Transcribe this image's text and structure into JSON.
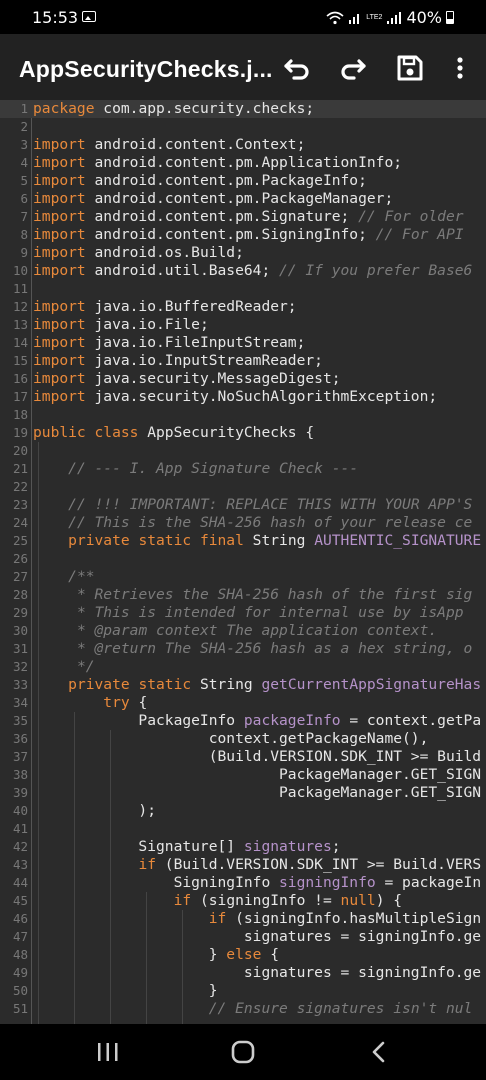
{
  "status_bar": {
    "time": "15:53",
    "battery": "40%",
    "network_label": "LTE2",
    "icons": [
      "image-icon",
      "wifi-icon",
      "signal-icon",
      "signal-icon",
      "battery-icon"
    ]
  },
  "toolbar": {
    "title": "AppSecurityChecks.j...",
    "buttons": [
      "undo-icon",
      "redo-icon",
      "save-icon",
      "more-vert-icon"
    ]
  },
  "editor": {
    "lines": [
      {
        "n": "1",
        "t": [
          [
            "kw",
            "package"
          ],
          [
            "p",
            " com.app.security.checks;"
          ]
        ]
      },
      {
        "n": "2",
        "t": []
      },
      {
        "n": "3",
        "t": [
          [
            "kw",
            "import"
          ],
          [
            "p",
            " android.content.Context;"
          ]
        ]
      },
      {
        "n": "4",
        "t": [
          [
            "kw",
            "import"
          ],
          [
            "p",
            " android.content.pm.ApplicationInfo;"
          ]
        ]
      },
      {
        "n": "5",
        "t": [
          [
            "kw",
            "import"
          ],
          [
            "p",
            " android.content.pm.PackageInfo;"
          ]
        ]
      },
      {
        "n": "6",
        "t": [
          [
            "kw",
            "import"
          ],
          [
            "p",
            " android.content.pm.PackageManager;"
          ]
        ]
      },
      {
        "n": "7",
        "t": [
          [
            "kw",
            "import"
          ],
          [
            "p",
            " android.content.pm.Signature; "
          ],
          [
            "cm",
            "// For older"
          ]
        ]
      },
      {
        "n": "8",
        "t": [
          [
            "kw",
            "import"
          ],
          [
            "p",
            " android.content.pm.SigningInfo; "
          ],
          [
            "cm",
            "// For API"
          ]
        ]
      },
      {
        "n": "9",
        "t": [
          [
            "kw",
            "import"
          ],
          [
            "p",
            " android.os.Build;"
          ]
        ]
      },
      {
        "n": "10",
        "t": [
          [
            "kw",
            "import"
          ],
          [
            "p",
            " android.util.Base64; "
          ],
          [
            "cm",
            "// If you prefer Base6"
          ]
        ]
      },
      {
        "n": "11",
        "t": []
      },
      {
        "n": "12",
        "t": [
          [
            "kw",
            "import"
          ],
          [
            "p",
            " java.io.BufferedReader;"
          ]
        ]
      },
      {
        "n": "13",
        "t": [
          [
            "kw",
            "import"
          ],
          [
            "p",
            " java.io.File;"
          ]
        ]
      },
      {
        "n": "14",
        "t": [
          [
            "kw",
            "import"
          ],
          [
            "p",
            " java.io.FileInputStream;"
          ]
        ]
      },
      {
        "n": "15",
        "t": [
          [
            "kw",
            "import"
          ],
          [
            "p",
            " java.io.InputStreamReader;"
          ]
        ]
      },
      {
        "n": "16",
        "t": [
          [
            "kw",
            "import"
          ],
          [
            "p",
            " java.security.MessageDigest;"
          ]
        ]
      },
      {
        "n": "17",
        "t": [
          [
            "kw",
            "import"
          ],
          [
            "p",
            " java.security.NoSuchAlgorithmException;"
          ]
        ]
      },
      {
        "n": "18",
        "t": []
      },
      {
        "n": "19",
        "t": [
          [
            "kw",
            "public class"
          ],
          [
            "p",
            " AppSecurityChecks {"
          ]
        ]
      },
      {
        "n": "20",
        "t": []
      },
      {
        "n": "21",
        "t": [
          [
            "p",
            "    "
          ],
          [
            "cm",
            "// --- I. App Signature Check ---"
          ]
        ]
      },
      {
        "n": "22",
        "t": []
      },
      {
        "n": "23",
        "t": [
          [
            "p",
            "    "
          ],
          [
            "cm",
            "// !!! IMPORTANT: REPLACE THIS WITH YOUR APP'S"
          ]
        ]
      },
      {
        "n": "24",
        "t": [
          [
            "p",
            "    "
          ],
          [
            "cm",
            "// This is the SHA-256 hash of your release ce"
          ]
        ]
      },
      {
        "n": "25",
        "t": [
          [
            "p",
            "    "
          ],
          [
            "kw",
            "private static final"
          ],
          [
            "p",
            " String "
          ],
          [
            "fld",
            "AUTHENTIC_SIGNATURE"
          ]
        ]
      },
      {
        "n": "26",
        "t": []
      },
      {
        "n": "27",
        "t": [
          [
            "p",
            "    "
          ],
          [
            "cm",
            "/**"
          ]
        ]
      },
      {
        "n": "28",
        "t": [
          [
            "p",
            "     "
          ],
          [
            "cm",
            "* Retrieves the SHA-256 hash of the first sig"
          ]
        ]
      },
      {
        "n": "29",
        "t": [
          [
            "p",
            "     "
          ],
          [
            "cm",
            "* This is intended for internal use by isApp"
          ]
        ]
      },
      {
        "n": "30",
        "t": [
          [
            "p",
            "     "
          ],
          [
            "cm",
            "* @param context The application context."
          ]
        ]
      },
      {
        "n": "31",
        "t": [
          [
            "p",
            "     "
          ],
          [
            "cm",
            "* @return The SHA-256 hash as a hex string, o"
          ]
        ]
      },
      {
        "n": "32",
        "t": [
          [
            "p",
            "     "
          ],
          [
            "cm",
            "*/"
          ]
        ]
      },
      {
        "n": "33",
        "t": [
          [
            "p",
            "    "
          ],
          [
            "kw",
            "private static"
          ],
          [
            "p",
            " String "
          ],
          [
            "fld",
            "getCurrentAppSignatureHas"
          ]
        ]
      },
      {
        "n": "34",
        "t": [
          [
            "p",
            "        "
          ],
          [
            "kw",
            "try"
          ],
          [
            "p",
            " {"
          ]
        ]
      },
      {
        "n": "35",
        "t": [
          [
            "p",
            "            PackageInfo "
          ],
          [
            "fld",
            "packageInfo"
          ],
          [
            "p",
            " = context.getPa"
          ]
        ]
      },
      {
        "n": "36",
        "t": [
          [
            "p",
            "                    context.getPackageName(),"
          ]
        ]
      },
      {
        "n": "37",
        "t": [
          [
            "p",
            "                    (Build.VERSION.SDK_INT >= Build"
          ]
        ]
      },
      {
        "n": "38",
        "t": [
          [
            "p",
            "                            PackageManager.GET_SIGN"
          ]
        ]
      },
      {
        "n": "39",
        "t": [
          [
            "p",
            "                            PackageManager.GET_SIGN"
          ]
        ]
      },
      {
        "n": "40",
        "t": [
          [
            "p",
            "            );"
          ]
        ]
      },
      {
        "n": "41",
        "t": []
      },
      {
        "n": "42",
        "t": [
          [
            "p",
            "            Signature[] "
          ],
          [
            "fld",
            "signatures"
          ],
          [
            "p",
            ";"
          ]
        ]
      },
      {
        "n": "43",
        "t": [
          [
            "p",
            "            "
          ],
          [
            "kw",
            "if"
          ],
          [
            "p",
            " (Build.VERSION.SDK_INT >= Build.VERS"
          ]
        ]
      },
      {
        "n": "44",
        "t": [
          [
            "p",
            "                SigningInfo "
          ],
          [
            "fld",
            "signingInfo"
          ],
          [
            "p",
            " = packageIn"
          ]
        ]
      },
      {
        "n": "45",
        "t": [
          [
            "p",
            "                "
          ],
          [
            "kw",
            "if"
          ],
          [
            "p",
            " (signingInfo != "
          ],
          [
            "kw",
            "null"
          ],
          [
            "p",
            ") {"
          ]
        ]
      },
      {
        "n": "46",
        "t": [
          [
            "p",
            "                    "
          ],
          [
            "kw",
            "if"
          ],
          [
            "p",
            " (signingInfo.hasMultipleSign"
          ]
        ]
      },
      {
        "n": "47",
        "t": [
          [
            "p",
            "                        signatures = signingInfo.ge"
          ]
        ]
      },
      {
        "n": "48",
        "t": [
          [
            "p",
            "                    } "
          ],
          [
            "kw",
            "else"
          ],
          [
            "p",
            " {"
          ]
        ]
      },
      {
        "n": "49",
        "t": [
          [
            "p",
            "                        signatures = signingInfo.ge"
          ]
        ]
      },
      {
        "n": "50",
        "t": [
          [
            "p",
            "                    }"
          ]
        ]
      },
      {
        "n": "51",
        "t": [
          [
            "p",
            "                    "
          ],
          [
            "cm",
            "// Ensure signatures isn't nul"
          ]
        ]
      }
    ]
  },
  "nav_bar": {
    "buttons": [
      "recents-icon",
      "home-icon",
      "back-icon"
    ]
  }
}
